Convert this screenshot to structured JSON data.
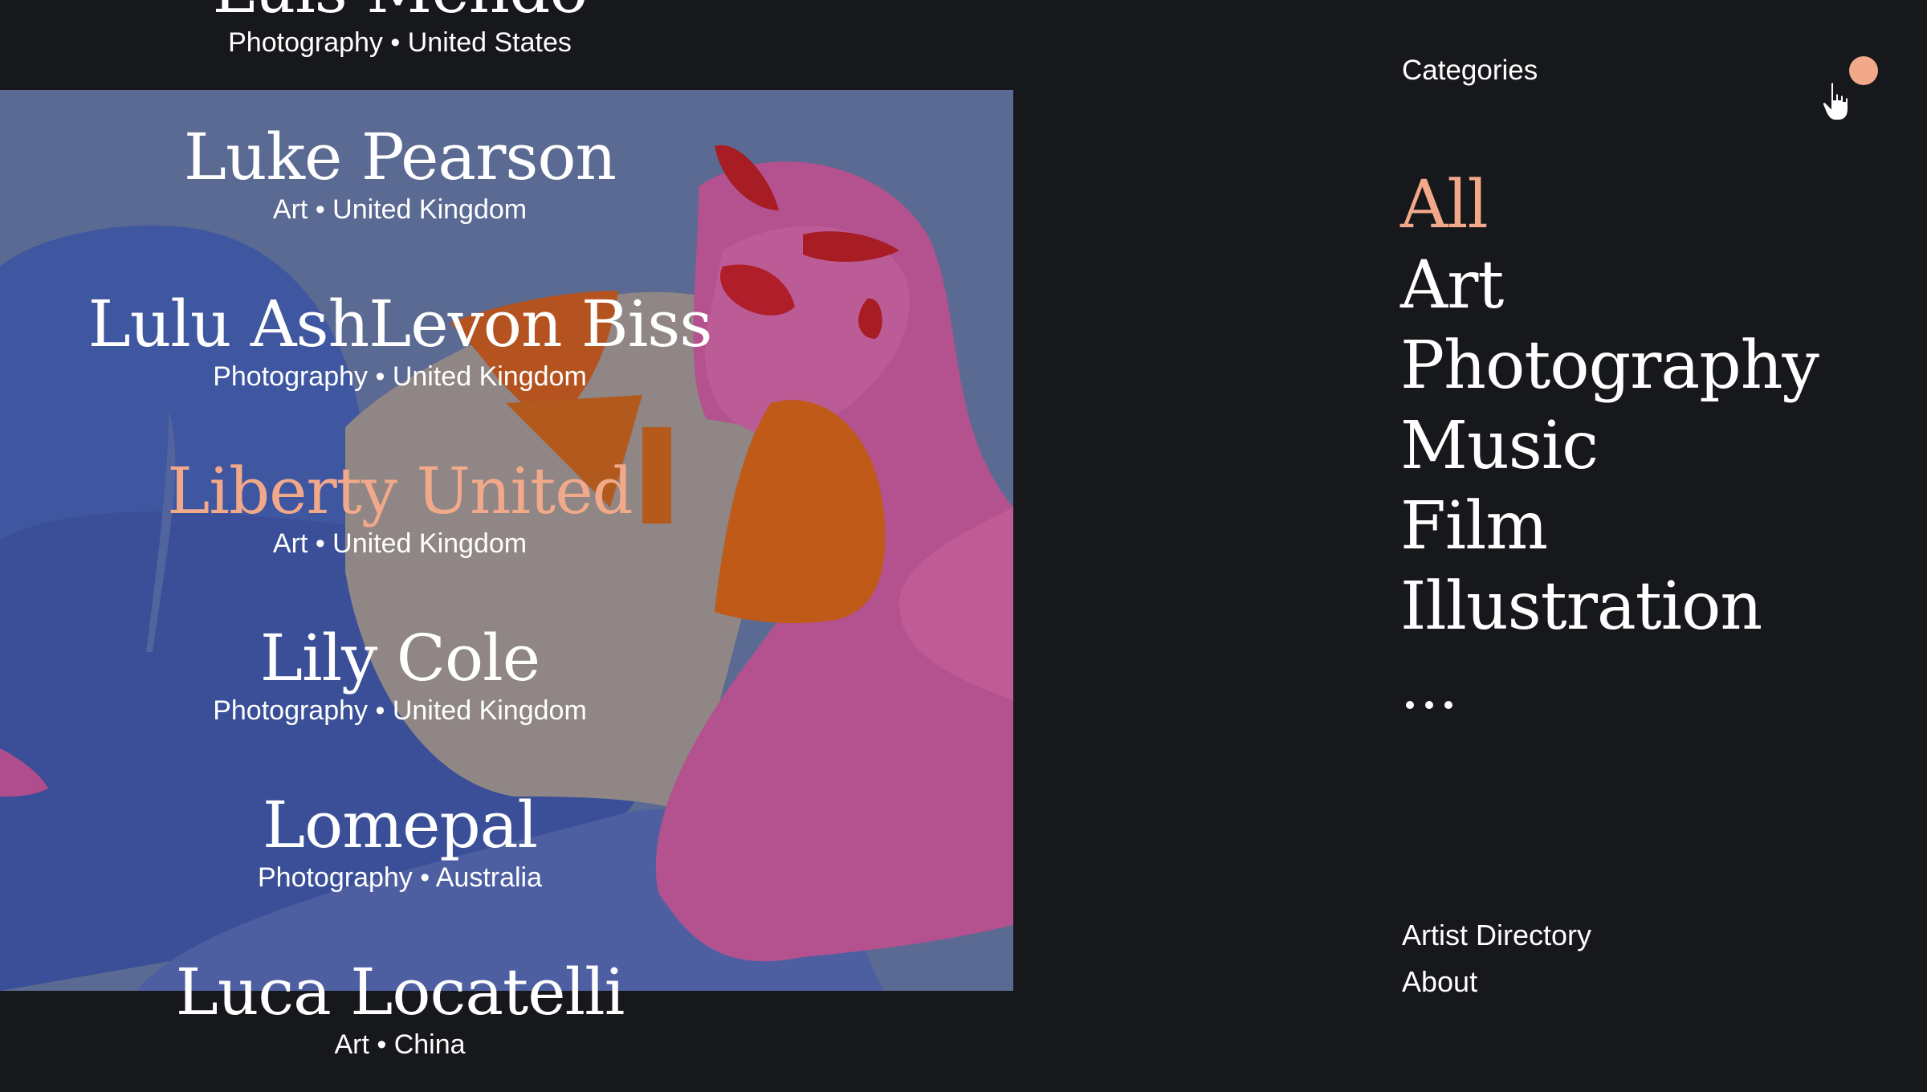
{
  "colors": {
    "background": "#17181b",
    "accent": "#f2a98a",
    "text": "#ffffff"
  },
  "artists": [
    {
      "name": "Luis Mendo",
      "category": "Photography",
      "country": "United States",
      "active": false
    },
    {
      "name": "Luke Pearson",
      "category": "Art",
      "country": "United Kingdom",
      "active": false
    },
    {
      "name": "Lulu AshLevon Biss",
      "category": "Photography",
      "country": "United Kingdom",
      "active": false
    },
    {
      "name": "Liberty United",
      "category": "Art",
      "country": "United Kingdom",
      "active": true
    },
    {
      "name": "Lily Cole",
      "category": "Photography",
      "country": "United Kingdom",
      "active": false
    },
    {
      "name": "Lomepal",
      "category": "Photography",
      "country": "Australia",
      "active": false
    },
    {
      "name": "Luca Locatelli",
      "category": "Art",
      "country": "China",
      "active": false
    }
  ],
  "meta_separator": "•",
  "sidebar": {
    "heading": "Categories",
    "categories": [
      {
        "label": "All",
        "active": true
      },
      {
        "label": "Art",
        "active": false
      },
      {
        "label": "Photography",
        "active": false
      },
      {
        "label": "Music",
        "active": false
      },
      {
        "label": "Film",
        "active": false
      },
      {
        "label": "Illustration",
        "active": false
      }
    ],
    "more_icon": "ellipsis-icon",
    "footer_links": [
      "Artist Directory",
      "About"
    ]
  },
  "icons": {
    "menu_dot": "menu-dot-icon",
    "cursor": "hand-pointer-cursor-icon"
  }
}
